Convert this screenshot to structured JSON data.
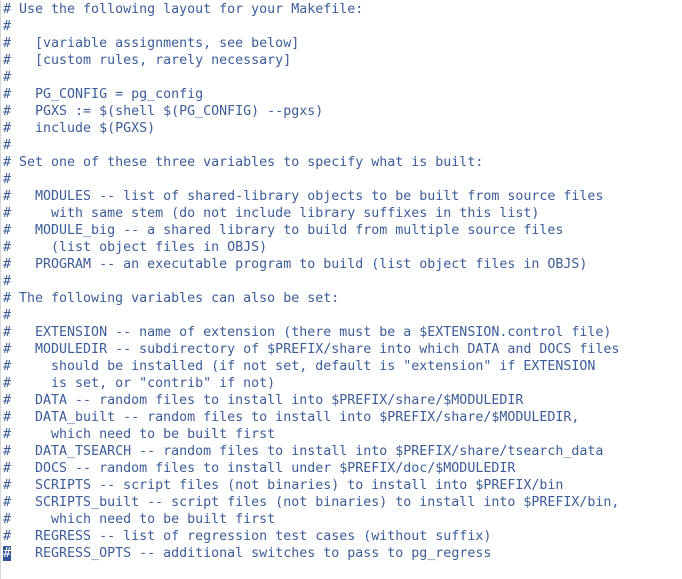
{
  "editor": {
    "colors": {
      "text": "#3b5d99",
      "cursor_bg": "#2f5596"
    },
    "lines": [
      "# Use the following layout for your Makefile:",
      "#",
      "#   [variable assignments, see below]",
      "#   [custom rules, rarely necessary]",
      "#",
      "#   PG_CONFIG = pg_config",
      "#   PGXS := $(shell $(PG_CONFIG) --pgxs)",
      "#   include $(PGXS)",
      "#",
      "# Set one of these three variables to specify what is built:",
      "#",
      "#   MODULES -- list of shared-library objects to be built from source files",
      "#     with same stem (do not include library suffixes in this list)",
      "#   MODULE_big -- a shared library to build from multiple source files",
      "#     (list object files in OBJS)",
      "#   PROGRAM -- an executable program to build (list object files in OBJS)",
      "#",
      "# The following variables can also be set:",
      "#",
      "#   EXTENSION -- name of extension (there must be a $EXTENSION.control file)",
      "#   MODULEDIR -- subdirectory of $PREFIX/share into which DATA and DOCS files",
      "#     should be installed (if not set, default is \"extension\" if EXTENSION",
      "#     is set, or \"contrib\" if not)",
      "#   DATA -- random files to install into $PREFIX/share/$MODULEDIR",
      "#   DATA_built -- random files to install into $PREFIX/share/$MODULEDIR,",
      "#     which need to be built first",
      "#   DATA_TSEARCH -- random files to install into $PREFIX/share/tsearch_data",
      "#   DOCS -- random files to install under $PREFIX/doc/$MODULEDIR",
      "#   SCRIPTS -- script files (not binaries) to install into $PREFIX/bin",
      "#   SCRIPTS_built -- script files (not binaries) to install into $PREFIX/bin,",
      "#     which need to be built first",
      "#   REGRESS -- list of regression test cases (without suffix)"
    ],
    "cursor_line": {
      "cursor_char": "#",
      "rest": "   REGRESS_OPTS -- additional switches to pass to pg_regress"
    }
  }
}
